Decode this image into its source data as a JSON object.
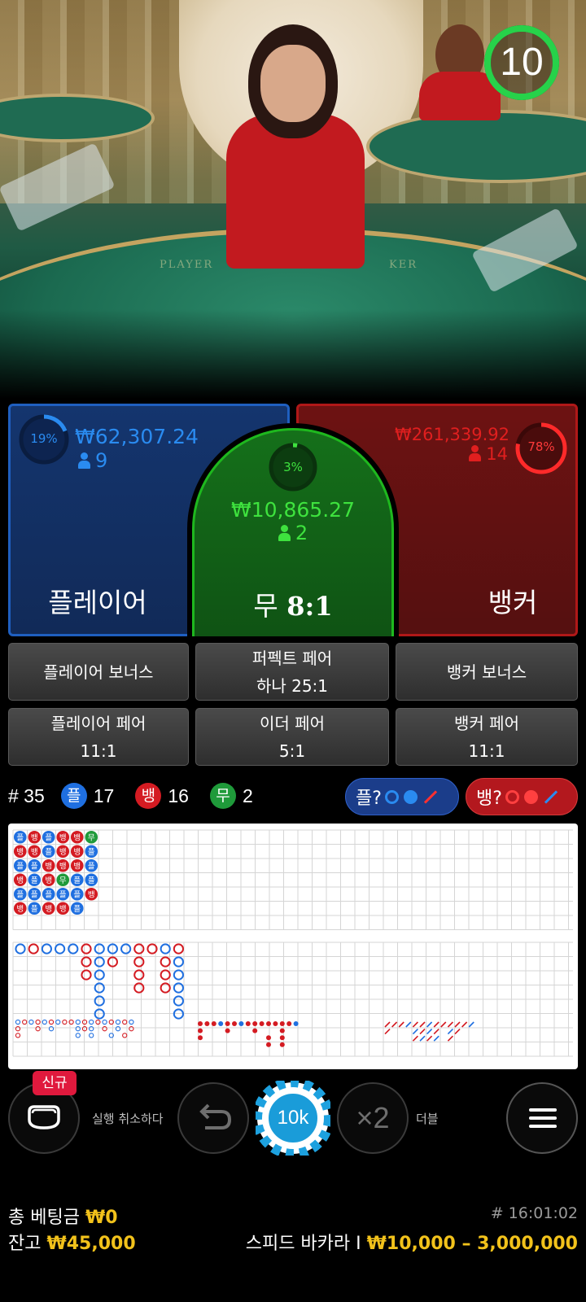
{
  "video": {
    "felt_player": "PLAYER",
    "felt_banker": "KER",
    "timer": "10"
  },
  "player": {
    "percent": "19%",
    "amount": "₩62,307.24",
    "count": "9",
    "label": "플레이어",
    "color": "#1f5fc0"
  },
  "tie": {
    "percent": "3%",
    "amount": "₩10,865.27",
    "count": "2",
    "label": "무",
    "odds": "8:1",
    "color": "#1eb81e"
  },
  "banker": {
    "percent": "78%",
    "amount": "₩261,339.92",
    "count": "14",
    "label": "뱅커",
    "color": "#b01818"
  },
  "side_bets": {
    "player_bonus": "플레이어 보너스",
    "perfect_pair_line1": "퍼펙트 페어",
    "perfect_pair_line2": "하나 25:1",
    "banker_bonus": "뱅커 보너스",
    "player_pair_line1": "플레이어 페어",
    "player_pair_line2": "11:1",
    "either_pair_line1": "이더 페어",
    "either_pair_line2": "5:1",
    "banker_pair_line1": "뱅커 페어",
    "banker_pair_line2": "11:1"
  },
  "stats": {
    "round_label": "# 35",
    "player_short": "플",
    "player_count": "17",
    "banker_short": "뱅",
    "banker_count": "16",
    "tie_short": "무",
    "tie_count": "2",
    "player_predict": "플?",
    "banker_predict": "뱅?"
  },
  "bead_road": [
    [
      "플",
      "뱅",
      "플",
      "뱅",
      "뱅",
      "무"
    ],
    [
      "뱅",
      "뱅",
      "플",
      "뱅",
      "뱅",
      "플"
    ],
    [
      "플",
      "플",
      "뱅",
      "뱅",
      "뱅",
      "플"
    ],
    [
      "뱅",
      "플",
      "뱅",
      "무",
      "플",
      "플"
    ],
    [
      "플",
      "플",
      "플",
      "플",
      "플",
      "뱅"
    ],
    [
      "뱅",
      "플",
      "뱅",
      "뱅",
      "플",
      ""
    ]
  ],
  "controls": {
    "new_badge": "신규",
    "undo_label": "실행 취소하다",
    "chip_value": "10k",
    "double_symbol": "×2",
    "double_label": "더블"
  },
  "footer": {
    "total_bet_label": "총 베팅금",
    "total_bet_value": "₩0",
    "balance_label": "잔고",
    "balance_value": "₩45,000",
    "round_id": "# 16:01:02",
    "game_name": "스피드 바카라 I",
    "limits": "₩10,000 – 3,000,000"
  },
  "colors": {
    "player_blue": "#1f6fe0",
    "banker_red": "#d41b22",
    "tie_green": "#1f9a3a",
    "accent_gold": "#f2c21b"
  }
}
